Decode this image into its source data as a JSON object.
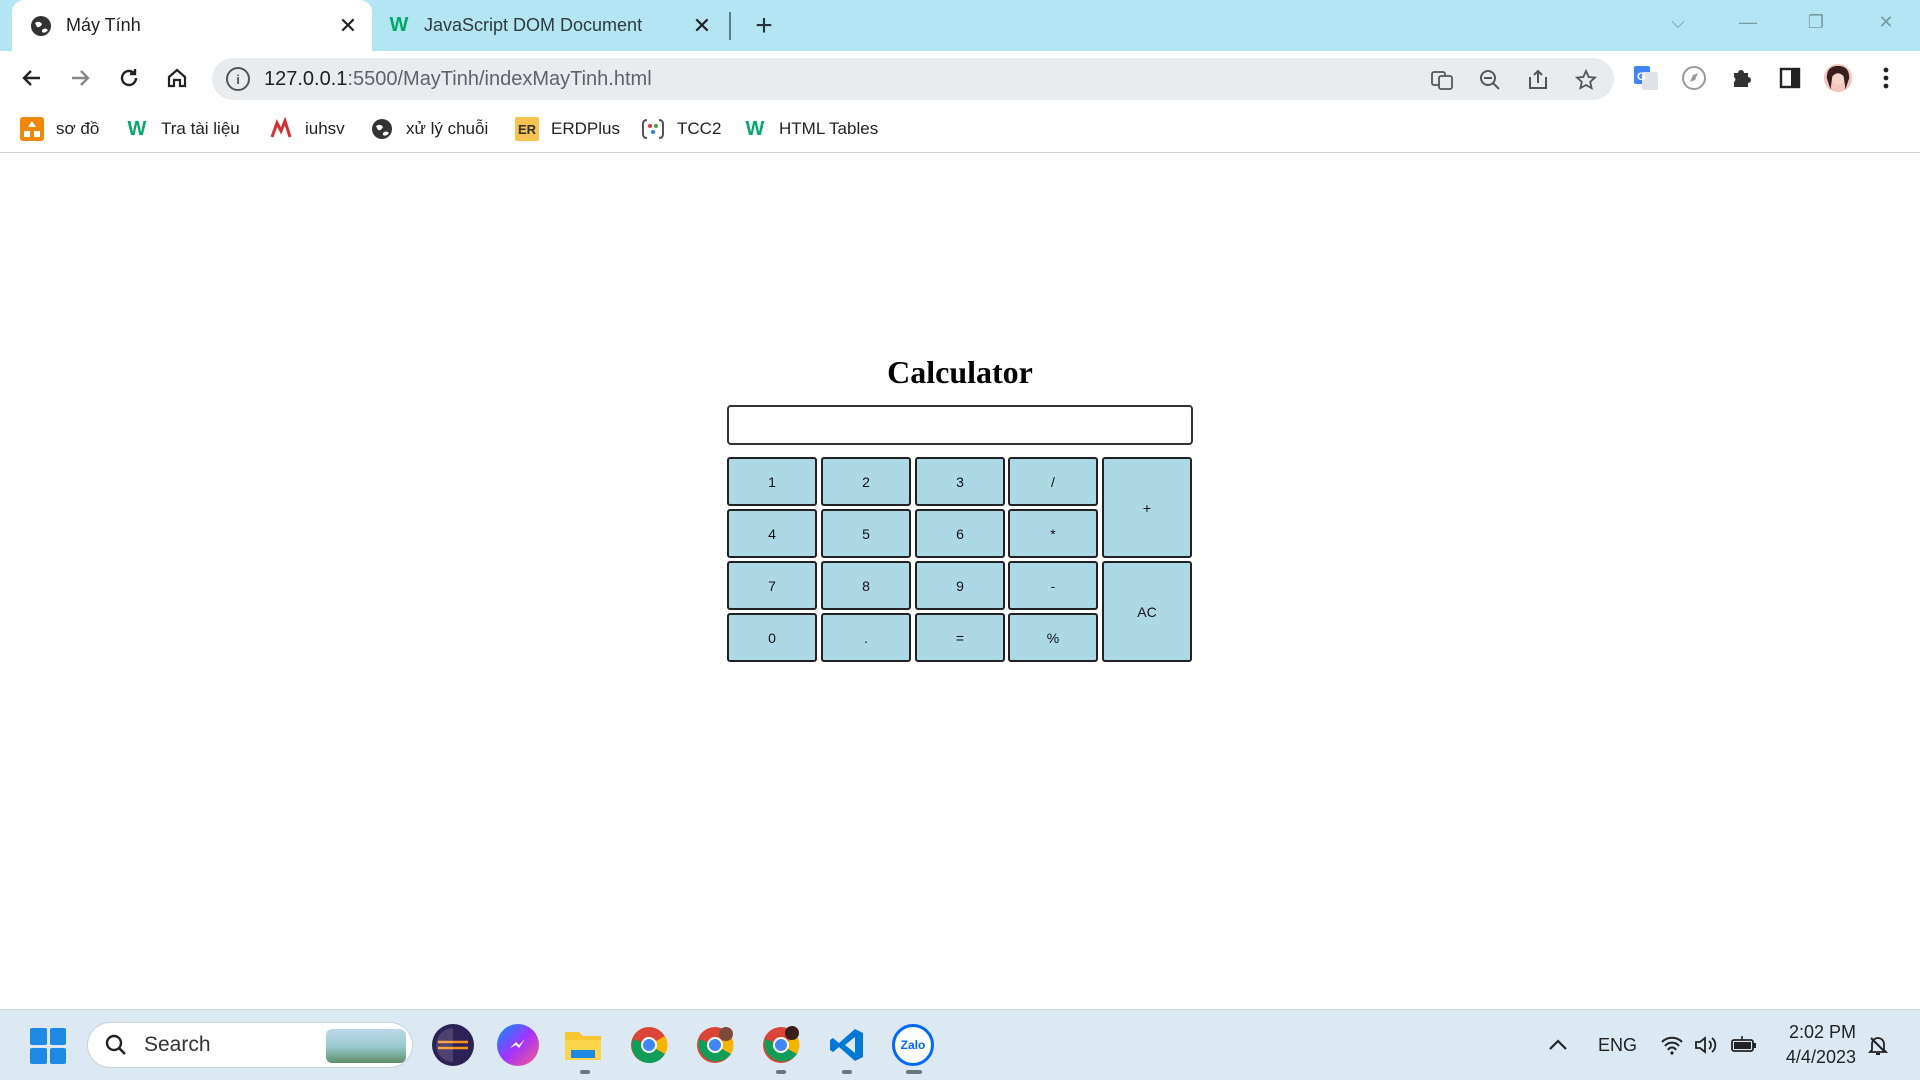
{
  "browser": {
    "tabs": [
      {
        "title": "Máy Tính",
        "active": true,
        "favicon": "globe-icon"
      },
      {
        "title": "JavaScript DOM Document",
        "active": false,
        "favicon": "w3schools-icon"
      }
    ],
    "new_tab_label": "+",
    "url": {
      "host": "127.0.0.1",
      "path": ":5500/MayTinh/indexMayTinh.html"
    },
    "bookmarks": [
      {
        "label": "sơ đồ",
        "icon": "diagram-icon"
      },
      {
        "label": "Tra tài liệu",
        "icon": "w3schools-icon"
      },
      {
        "label": "iuhsv",
        "icon": "iuh-icon"
      },
      {
        "label": "xử lý chuỗi",
        "icon": "globe-icon"
      },
      {
        "label": "ERDPlus",
        "icon": "erdplus-icon"
      },
      {
        "label": "TCC2",
        "icon": "tcc-icon"
      },
      {
        "label": "HTML Tables",
        "icon": "w3schools-icon"
      }
    ],
    "er_badge": "ER",
    "w3_badge": "W"
  },
  "calculator": {
    "title": "Calculator",
    "display_value": "",
    "keys": {
      "k1": "1",
      "k2": "2",
      "k3": "3",
      "div": "/",
      "plus": "+",
      "k4": "4",
      "k5": "5",
      "k6": "6",
      "mul": "*",
      "k7": "7",
      "k8": "8",
      "k9": "9",
      "minus": "-",
      "ac": "AC",
      "k0": "0",
      "dot": ".",
      "eq": "=",
      "pct": "%"
    }
  },
  "taskbar": {
    "search_label": "Search",
    "language": "ENG",
    "time": "2:02 PM",
    "date": "4/4/2023",
    "zalo_label": "Zalo"
  },
  "colors": {
    "tab_bar": "#b3e5f2",
    "key_bg": "#add8e6",
    "taskbar": "#dce8f2"
  }
}
